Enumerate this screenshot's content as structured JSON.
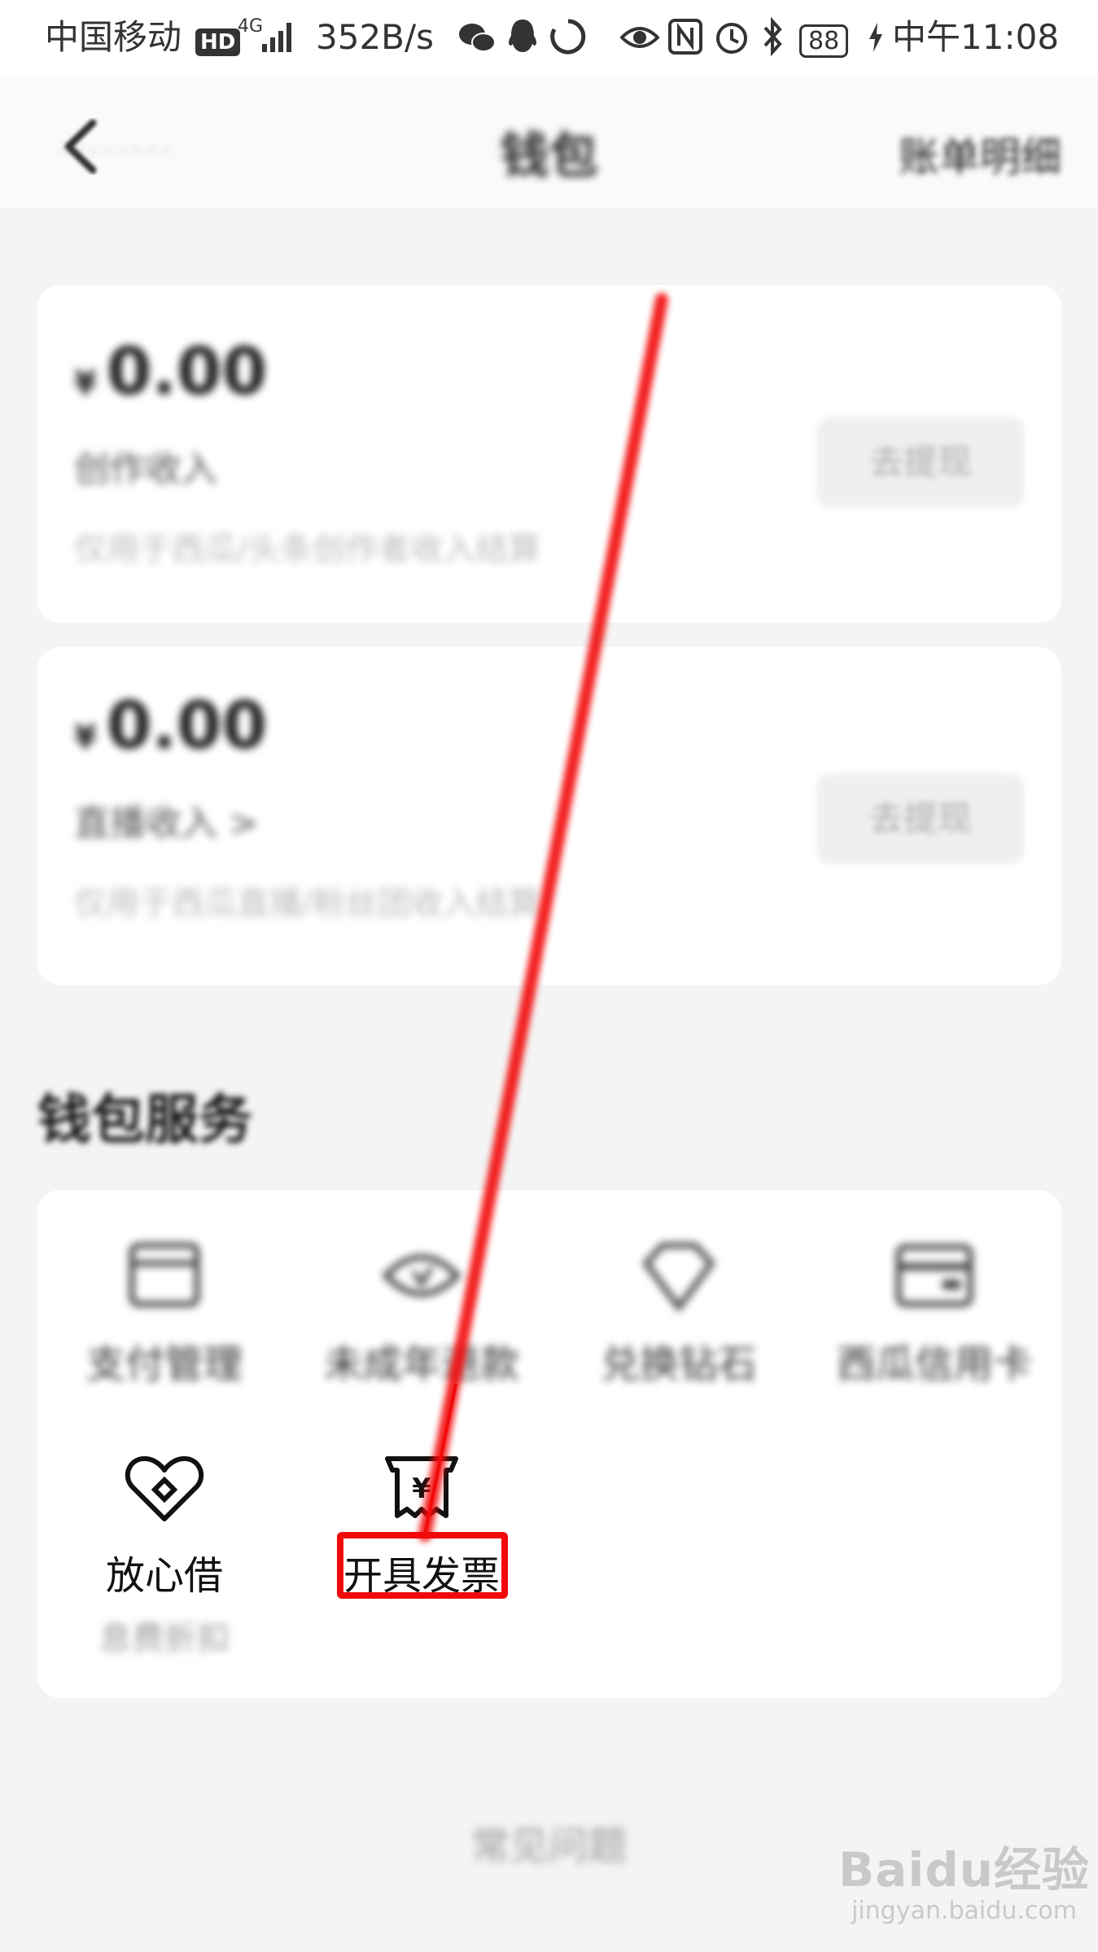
{
  "status_bar": {
    "carrier": "中国移动",
    "hd": "HD",
    "network": "4G",
    "speed": "352B/s",
    "battery": "88",
    "time": "中午11:08"
  },
  "header": {
    "title": "钱包",
    "bill_link": "账单明细"
  },
  "cards": [
    {
      "currency": "¥",
      "amount": "0.00",
      "label": "创作收入",
      "desc": "仅用于西瓜/头条创作者收入结算",
      "button": "去提现"
    },
    {
      "currency": "¥",
      "amount": "0.00",
      "label": "直播收入 >",
      "desc": "仅用于西瓜直播/粉丝团收入结算",
      "button": "去提现"
    }
  ],
  "section_title": "钱包服务",
  "services": [
    {
      "label": "支付管理",
      "icon": "wallet-icon"
    },
    {
      "label": "未成年退款",
      "icon": "eye-shield-icon"
    },
    {
      "label": "兑换钻石",
      "icon": "diamond-icon"
    },
    {
      "label": "西瓜信用卡",
      "icon": "credit-card-icon"
    },
    {
      "label": "放心借",
      "icon": "heart-diamond-icon"
    },
    {
      "label": "开具发票",
      "icon": "invoice-icon"
    }
  ],
  "service_note": "息费折扣",
  "faq": "常见问题",
  "watermark": {
    "brand": "Baidu经验",
    "url": "jingyan.baidu.com"
  },
  "colors": {
    "annotation_red": "#f20a0a",
    "background": "#f4f4f4"
  }
}
